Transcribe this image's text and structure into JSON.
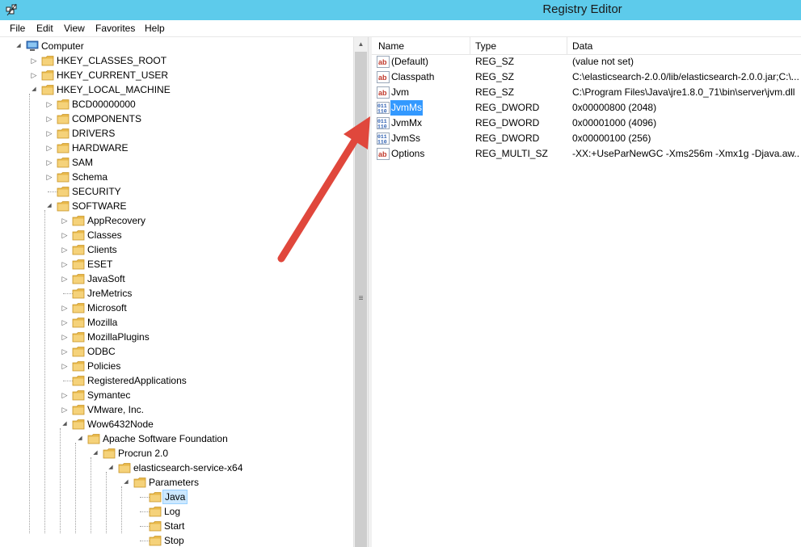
{
  "window": {
    "title": "Registry Editor"
  },
  "menu": [
    {
      "label": "File"
    },
    {
      "label": "Edit"
    },
    {
      "label": "View"
    },
    {
      "label": "Favorites"
    },
    {
      "label": "Help"
    }
  ],
  "tree": [
    {
      "label": "Computer",
      "level": 0,
      "toggle": "open",
      "icon": "computer-icon"
    },
    {
      "label": "HKEY_CLASSES_ROOT",
      "level": 1,
      "toggle": "closed"
    },
    {
      "label": "HKEY_CURRENT_USER",
      "level": 1,
      "toggle": "closed"
    },
    {
      "label": "HKEY_LOCAL_MACHINE",
      "level": 1,
      "toggle": "open"
    },
    {
      "label": "BCD00000000",
      "level": 2,
      "toggle": "closed"
    },
    {
      "label": "COMPONENTS",
      "level": 2,
      "toggle": "closed"
    },
    {
      "label": "DRIVERS",
      "level": 2,
      "toggle": "closed"
    },
    {
      "label": "HARDWARE",
      "level": 2,
      "toggle": "closed"
    },
    {
      "label": "SAM",
      "level": 2,
      "toggle": "closed"
    },
    {
      "label": "Schema",
      "level": 2,
      "toggle": "closed"
    },
    {
      "label": "SECURITY",
      "level": 2,
      "toggle": "none"
    },
    {
      "label": "SOFTWARE",
      "level": 2,
      "toggle": "open"
    },
    {
      "label": "AppRecovery",
      "level": 3,
      "toggle": "closed"
    },
    {
      "label": "Classes",
      "level": 3,
      "toggle": "closed"
    },
    {
      "label": "Clients",
      "level": 3,
      "toggle": "closed"
    },
    {
      "label": "ESET",
      "level": 3,
      "toggle": "closed"
    },
    {
      "label": "JavaSoft",
      "level": 3,
      "toggle": "closed"
    },
    {
      "label": "JreMetrics",
      "level": 3,
      "toggle": "none"
    },
    {
      "label": "Microsoft",
      "level": 3,
      "toggle": "closed"
    },
    {
      "label": "Mozilla",
      "level": 3,
      "toggle": "closed"
    },
    {
      "label": "MozillaPlugins",
      "level": 3,
      "toggle": "closed"
    },
    {
      "label": "ODBC",
      "level": 3,
      "toggle": "closed"
    },
    {
      "label": "Policies",
      "level": 3,
      "toggle": "closed"
    },
    {
      "label": "RegisteredApplications",
      "level": 3,
      "toggle": "none"
    },
    {
      "label": "Symantec",
      "level": 3,
      "toggle": "closed"
    },
    {
      "label": "VMware, Inc.",
      "level": 3,
      "toggle": "closed"
    },
    {
      "label": "Wow6432Node",
      "level": 3,
      "toggle": "open"
    },
    {
      "label": "Apache Software Foundation",
      "level": 4,
      "toggle": "open"
    },
    {
      "label": "Procrun 2.0",
      "level": 5,
      "toggle": "open"
    },
    {
      "label": "elasticsearch-service-x64",
      "level": 6,
      "toggle": "open"
    },
    {
      "label": "Parameters",
      "level": 7,
      "toggle": "open"
    },
    {
      "label": "Java",
      "level": 8,
      "toggle": "none",
      "selected": true
    },
    {
      "label": "Log",
      "level": 8,
      "toggle": "none"
    },
    {
      "label": "Start",
      "level": 8,
      "toggle": "none"
    },
    {
      "label": "Stop",
      "level": 8,
      "toggle": "none"
    }
  ],
  "list": {
    "columns": {
      "name": "Name",
      "type": "Type",
      "data": "Data"
    },
    "rows": [
      {
        "name": "(Default)",
        "type": "REG_SZ",
        "data": "(value not set)",
        "icon": "string-value-icon"
      },
      {
        "name": "Classpath",
        "type": "REG_SZ",
        "data": "C:\\elasticsearch-2.0.0/lib/elasticsearch-2.0.0.jar;C:\\...",
        "icon": "string-value-icon"
      },
      {
        "name": "Jvm",
        "type": "REG_SZ",
        "data": "C:\\Program Files\\Java\\jre1.8.0_71\\bin\\server\\jvm.dll",
        "icon": "string-value-icon"
      },
      {
        "name": "JvmMs",
        "type": "REG_DWORD",
        "data": "0x00000800 (2048)",
        "icon": "binary-value-icon",
        "selected": true
      },
      {
        "name": "JvmMx",
        "type": "REG_DWORD",
        "data": "0x00001000 (4096)",
        "icon": "binary-value-icon"
      },
      {
        "name": "JvmSs",
        "type": "REG_DWORD",
        "data": "0x00000100 (256)",
        "icon": "binary-value-icon"
      },
      {
        "name": "Options",
        "type": "REG_MULTI_SZ",
        "data": "-XX:+UseParNewGC -Xms256m -Xmx1g -Djava.aw...",
        "icon": "string-value-icon"
      }
    ]
  },
  "colors": {
    "titlebar": "#5dcbeb",
    "selection": "#3399ff",
    "tree_selection": "#cce8ff",
    "arrow": "#e0473c",
    "folder": "#e8b84a"
  }
}
